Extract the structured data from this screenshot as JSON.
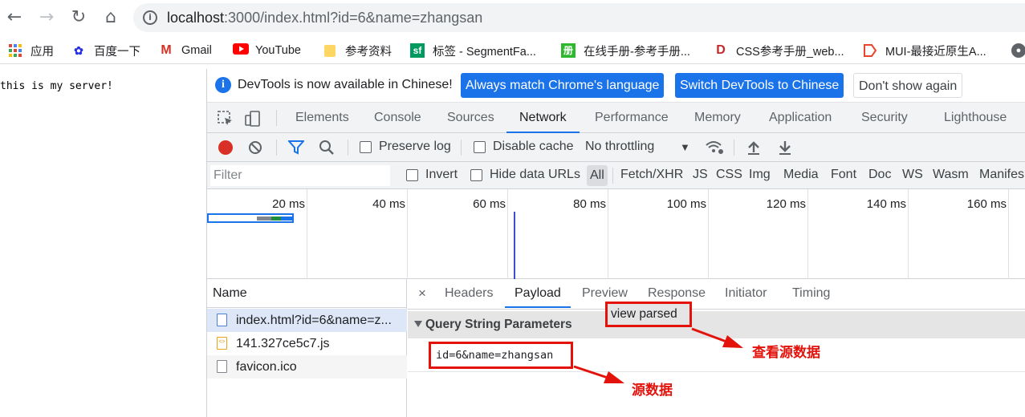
{
  "browser": {
    "url_host": "localhost",
    "url_rest": ":3000/index.html?id=6&name=zhangsan"
  },
  "bookmarks": [
    {
      "label": "应用",
      "icon": "apps-grid-icon"
    },
    {
      "label": "百度一下",
      "icon": "baidu-paw-icon"
    },
    {
      "label": "Gmail",
      "icon": "gmail-icon"
    },
    {
      "label": "YouTube",
      "icon": "youtube-icon"
    },
    {
      "label": "参考资料",
      "icon": "folder-icon"
    },
    {
      "label": "标签 - SegmentFa...",
      "icon": "segmentfault-icon"
    },
    {
      "label": "在线手册-参考手册...",
      "icon": "manual-icon"
    },
    {
      "label": "CSS参考手册_web...",
      "icon": "css-ref-icon"
    },
    {
      "label": "MUI-最接近原生A...",
      "icon": "mui-icon"
    }
  ],
  "page": {
    "text": "this is my server!"
  },
  "devtools": {
    "infobar": {
      "message": "DevTools is now available in Chinese!",
      "btn_match": "Always match Chrome's language",
      "btn_switch": "Switch DevTools to Chinese",
      "btn_dismiss": "Don't show again"
    },
    "tabs": [
      "Elements",
      "Console",
      "Sources",
      "Network",
      "Performance",
      "Memory",
      "Application",
      "Security",
      "Lighthouse"
    ],
    "active_tab": "Network",
    "toolbar": {
      "preserve_log": "Preserve log",
      "disable_cache": "Disable cache",
      "throttling": "No throttling"
    },
    "filter": {
      "placeholder": "Filter",
      "invert": "Invert",
      "hide_data_urls": "Hide data URLs",
      "types": [
        "All",
        "Fetch/XHR",
        "JS",
        "CSS",
        "Img",
        "Media",
        "Font",
        "Doc",
        "WS",
        "Wasm",
        "Manifes"
      ]
    },
    "timeline_ticks": [
      "20 ms",
      "40 ms",
      "60 ms",
      "80 ms",
      "100 ms",
      "120 ms",
      "140 ms",
      "160 ms"
    ],
    "requests": {
      "header": "Name",
      "rows": [
        {
          "name": "index.html?id=6&name=z...",
          "icon": "document-icon"
        },
        {
          "name": "141.327ce5c7.js",
          "icon": "script-file-icon"
        },
        {
          "name": "favicon.ico",
          "icon": "file-icon"
        }
      ]
    },
    "detail": {
      "close": "×",
      "tabs": [
        "Headers",
        "Payload",
        "Preview",
        "Response",
        "Initiator",
        "Timing"
      ],
      "active_tab": "Payload",
      "section_title": "Query String Parameters",
      "view_parsed": "view parsed",
      "raw_query": "id=6&name=zhangsan"
    }
  },
  "annotations": {
    "view_source": "查看源数据",
    "source": "源数据"
  },
  "colors": {
    "accent": "#1a73e8",
    "record": "#d93025",
    "annotation": "#e3120b"
  }
}
